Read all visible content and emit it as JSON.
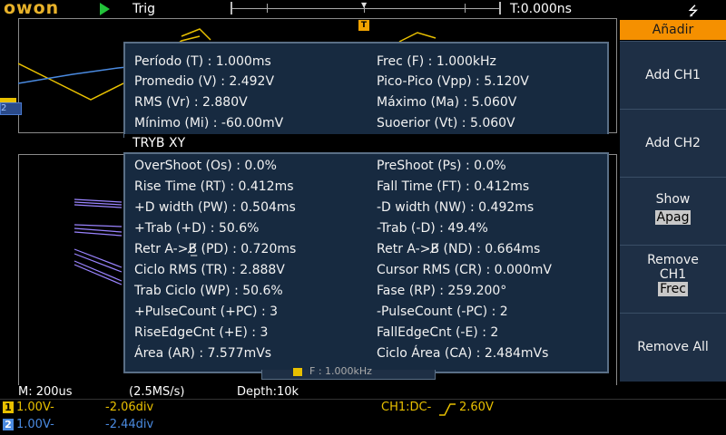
{
  "top_bar": {
    "logo": "owon",
    "run_state_icon": "play-icon",
    "trigger_label": "Trig",
    "trigger_time": "T:0.000ns",
    "usb_icon": "usb-icon"
  },
  "trigger_marker": "T",
  "ch2_marker": "2",
  "measurements_top": [
    {
      "label": "Período (T) : 1.000ms",
      "col": 0
    },
    {
      "label": "Frec (F) : 1.000kHz",
      "col": 1
    },
    {
      "label": "Promedio (V) : 2.492V",
      "col": 0
    },
    {
      "label": "Pico-Pico (Vpp) : 5.120V",
      "col": 1
    },
    {
      "label": "RMS (Vr) : 2.880V",
      "col": 0
    },
    {
      "label": "Máximo (Ma) : 5.060V",
      "col": 1
    },
    {
      "label": "Mínimo (Mi) : -60.00mV",
      "col": 0
    },
    {
      "label": "Suoerior (Vt) : 5.060V",
      "col": 1
    }
  ],
  "tryb_label": "TRYB XY",
  "measurements_bottom": [
    [
      "OverShoot (Os) : 0.0%",
      "PreShoot (Ps) : 0.0%"
    ],
    [
      "Rise Time (RT) : 0.412ms",
      "Fall Time (FT) : 0.412ms"
    ],
    [
      "+D width (PW) : 0.504ms",
      "-D width (NW) : 0.492ms"
    ],
    [
      "+Trab (+D) : 50.6%",
      "-Trab (-D) : 49.4%"
    ],
    [
      "Retr A->B̸̲ (PD) : 0.720ms",
      "Retr A->B̸ (ND) : 0.664ms"
    ],
    [
      "Ciclo RMS (TR) : 2.888V",
      "Cursor RMS (CR) : 0.000mV"
    ],
    [
      "Trab Ciclo (WP) : 50.6%",
      "Fase (RP) : 259.200°"
    ],
    [
      "+PulseCount (+PC) : 3",
      "-PulseCount (-PC) : 2"
    ],
    [
      "RiseEdgeCnt (+E) : 3",
      "FallEdgeCnt (-E) : 2"
    ],
    [
      "Área (AR) : 7.577mVs",
      "Ciclo Área (CA) : 2.484mVs"
    ]
  ],
  "menu": {
    "title": "Añadir",
    "add_ch1": "Add CH1",
    "add_ch2": "Add CH2",
    "show_label": "Show",
    "show_value": "Apag",
    "remove_label": "Remove",
    "remove_ch": "CH1",
    "remove_value": "Frec",
    "remove_all": "Remove All"
  },
  "hidden_partial": "F : 1.000kHz",
  "status": {
    "timebase": "M: 200us",
    "sample_rate": "(2.5MS/s)",
    "depth": "Depth:10k",
    "ch1_num": "1",
    "ch1_scale": "1.00V-",
    "ch1_offset": "-2.06div",
    "ch2_num": "2",
    "ch2_scale": "1.00V-",
    "ch2_offset": "-2.44div",
    "trigger_info": "CH1:DC-",
    "trigger_level": "2.60V"
  },
  "colors": {
    "ch1": "#e8c000",
    "ch2": "#4a8ae0",
    "math": "#a080ff",
    "accent": "#f59000"
  }
}
